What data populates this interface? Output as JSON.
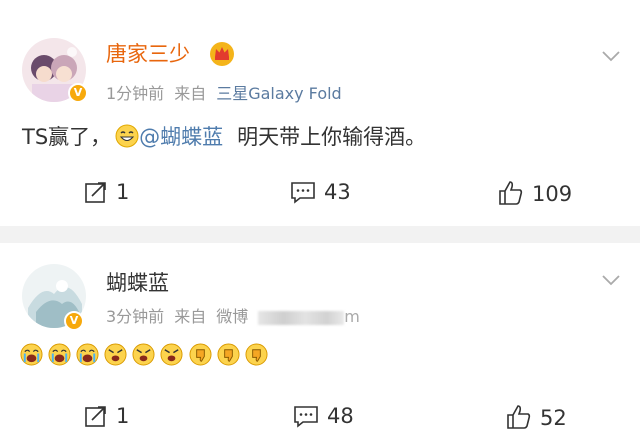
{
  "posts": [
    {
      "username": "唐家三少",
      "time": "1分钟前",
      "from_label": "来自",
      "source": "三星Galaxy Fold",
      "content": {
        "before": "TS赢了，",
        "mention": "@蝴蝶蓝",
        "after": "明天带上你输得酒。"
      },
      "actions": {
        "share": "1",
        "comment": "43",
        "like": "109"
      },
      "colors": {
        "username": "#e8660d",
        "mention": "#4f7cad"
      }
    },
    {
      "username": "蝴蝶蓝",
      "time": "3分钟前",
      "from_label": "来自",
      "source": "微博",
      "source_tail": "m",
      "emojis": [
        "crying-face-icon",
        "crying-face-icon",
        "crying-face-icon",
        "angry-face-icon",
        "angry-face-icon",
        "angry-face-icon",
        "thumbs-down-icon",
        "thumbs-down-icon",
        "thumbs-down-icon"
      ],
      "actions": {
        "share": "1",
        "comment": "48",
        "like": "52"
      },
      "colors": {
        "username": "#333333"
      }
    }
  ]
}
